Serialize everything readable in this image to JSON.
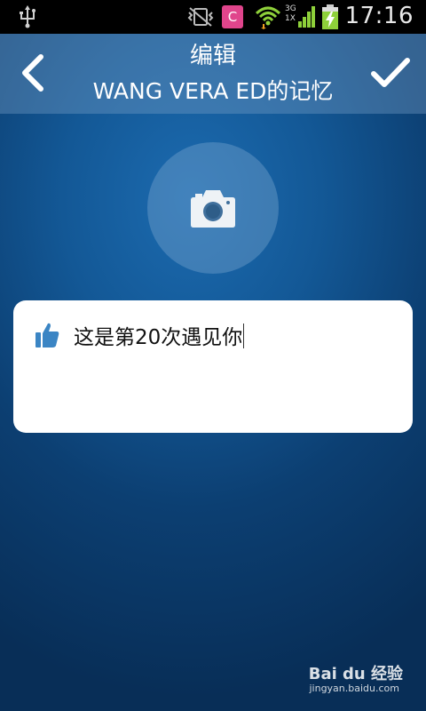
{
  "status_bar": {
    "time": "17:16",
    "network_labels": [
      "3G",
      "1X"
    ],
    "icons": [
      "usb-icon",
      "vibrate-off-icon",
      "app-c-icon",
      "wifi-icon",
      "signal-icon",
      "battery-charging-icon"
    ],
    "app_icon_letter": "C"
  },
  "header": {
    "title": "编辑",
    "subtitle": "WANG VERA ED的记忆",
    "back_icon": "chevron-left-icon",
    "confirm_icon": "checkmark-icon"
  },
  "photo": {
    "icon": "camera-icon"
  },
  "note": {
    "icon": "thumbs-up-icon",
    "text": "这是第20次遇见你"
  },
  "watermark": {
    "brand": "Bai du 经验",
    "url": "jingyan.baidu.com"
  },
  "colors": {
    "background": "#135896",
    "header_overlay": "#5d88b3",
    "card": "#ffffff",
    "thumb_icon": "#3b85c4",
    "app_icon": "#e0458c",
    "battery": "#8ed03a"
  }
}
